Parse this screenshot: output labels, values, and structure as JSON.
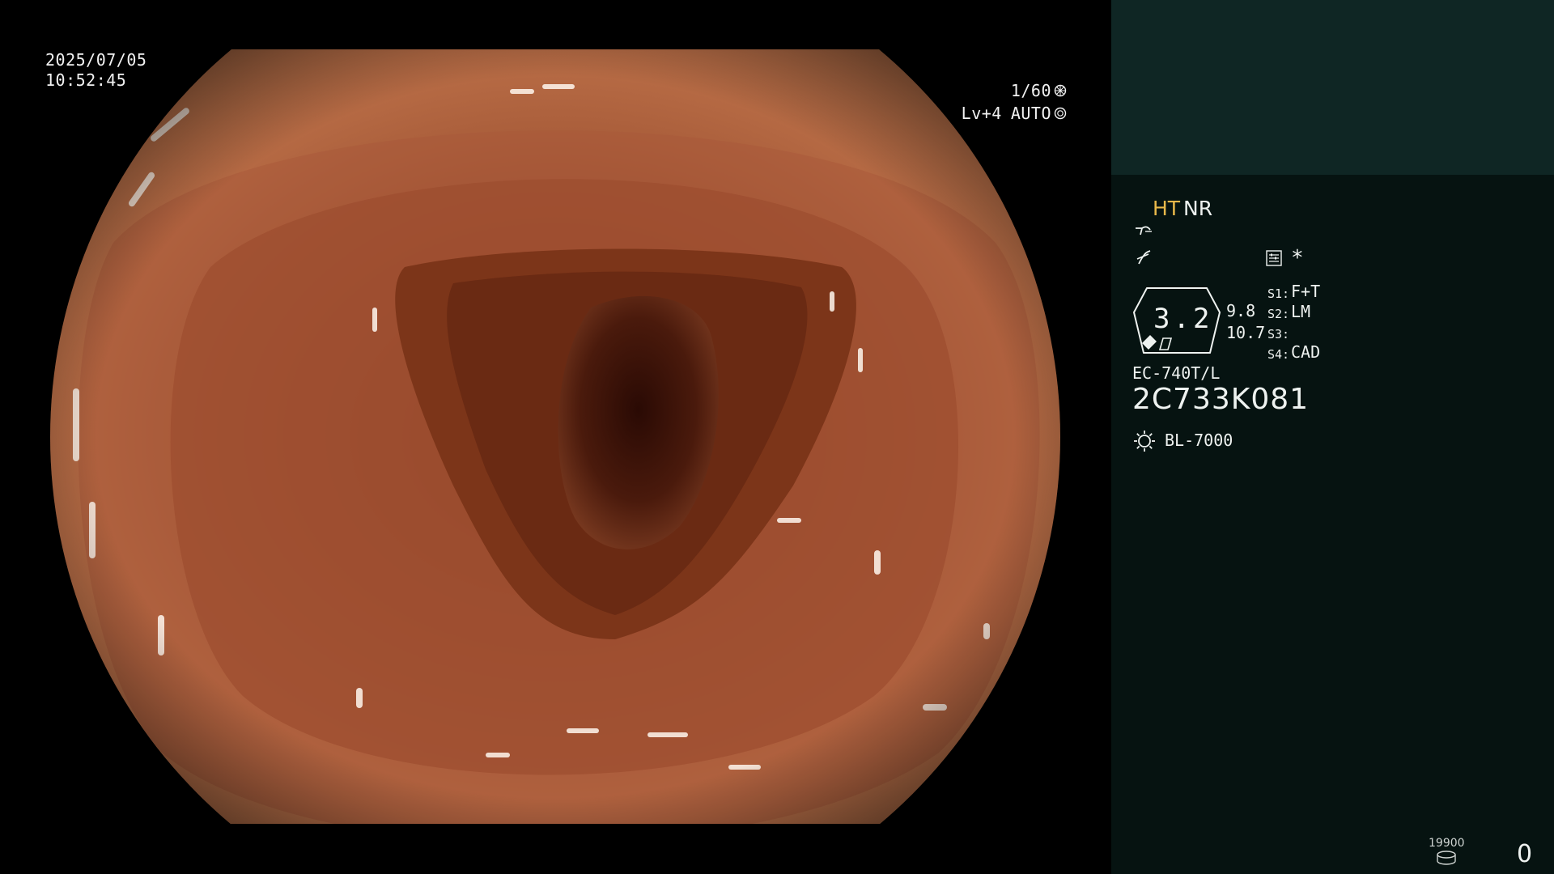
{
  "overlay": {
    "date": "2025/07/05",
    "time": "10:52:45",
    "shutter": "1/60",
    "shutter_icon": "aperture-icon",
    "exposure_level": "Lv+4",
    "exposure_mode": "AUTO",
    "exposure_icon": "iris-icon"
  },
  "panel": {
    "mode_ht": "HT",
    "mode_nr": "NR",
    "structure_icon": "structure-enhance-icon",
    "color_icon": "color-enhance-icon",
    "menu_icon": "settings-list-icon",
    "asterisk": "*",
    "magnification": "3.2",
    "value_a": "9.8",
    "value_b": "10.7",
    "switches": [
      {
        "label": "S1:",
        "value": "F+T"
      },
      {
        "label": "S2:",
        "value": "LM"
      },
      {
        "label": "S3:",
        "value": ""
      },
      {
        "label": "S4:",
        "value": "CAD"
      }
    ],
    "scope_model": "EC-740T/L",
    "serial_number": "2C733K081",
    "light_source_icon": "light-source-icon",
    "light_source": "BL-7000",
    "storage_capacity": "19900",
    "storage_icon": "storage-disk-icon",
    "capture_count": "0"
  },
  "colors": {
    "panel_top": "#0f2624",
    "panel_bottom": "#061311",
    "mode_highlight": "#e8b84a",
    "mucosa": "#b86a45"
  }
}
